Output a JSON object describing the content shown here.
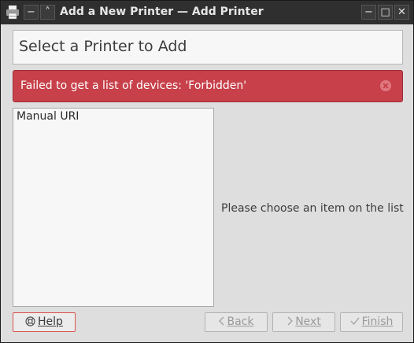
{
  "window": {
    "title": "Add a New Printer — Add Printer",
    "controls": {
      "shade": "−",
      "roll": "˄",
      "minimize": "−",
      "maximize": "□",
      "close": "✕"
    }
  },
  "header": {
    "title": "Select a Printer to Add"
  },
  "error": {
    "message": "Failed to get a list of devices: 'Forbidden'"
  },
  "device_list": {
    "items": [
      "Manual URI"
    ]
  },
  "hint": "Please choose an item on the list",
  "buttons": {
    "help": {
      "label": "Help",
      "icon": "lifebuoy-icon"
    },
    "back": {
      "label": "Back",
      "icon": "chevron-left-icon"
    },
    "next": {
      "label": "Next",
      "icon": "chevron-right-icon"
    },
    "finish": {
      "label": "Finish",
      "icon": "checkmark-icon"
    }
  },
  "colors": {
    "error_bg": "#c7404a",
    "titlebar_bg": "#2f2f2f",
    "window_bg": "#dedede"
  }
}
